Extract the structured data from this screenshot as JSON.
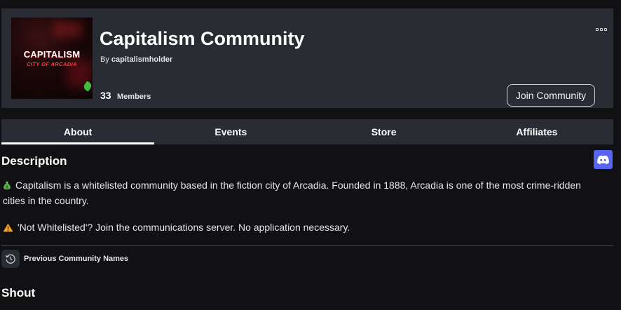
{
  "community": {
    "name": "Capitalism Community",
    "by_prefix": "By",
    "owner": "capitalismholder",
    "member_count": "33",
    "members_label": "Members",
    "join_label": "Join Community",
    "thumbnail": {
      "line1": "CAPITALISM",
      "line2": "CITY OF ARCADIA"
    }
  },
  "tabs": [
    {
      "label": "About",
      "active": true
    },
    {
      "label": "Events",
      "active": false
    },
    {
      "label": "Store",
      "active": false
    },
    {
      "label": "Affiliates",
      "active": false
    }
  ],
  "description": {
    "heading": "Description",
    "paragraph1": "Capitalism is a whitelisted community based in the fiction city of Arcadia. Founded in 1888, Arcadia is one of the most crime-ridden cities in the country.",
    "paragraph1_icon": "money-bag-icon",
    "paragraph2": "'Not Whitelisted'? Join the communications server. No application necessary.",
    "paragraph2_icon": "warning-icon"
  },
  "previous_names": {
    "label": "Previous Community Names",
    "icon": "history-icon"
  },
  "shout": {
    "heading": "Shout"
  },
  "colors": {
    "background": "#111114",
    "card": "#2a2c33",
    "discord": "#5865f2",
    "warning": "#f5a623"
  }
}
